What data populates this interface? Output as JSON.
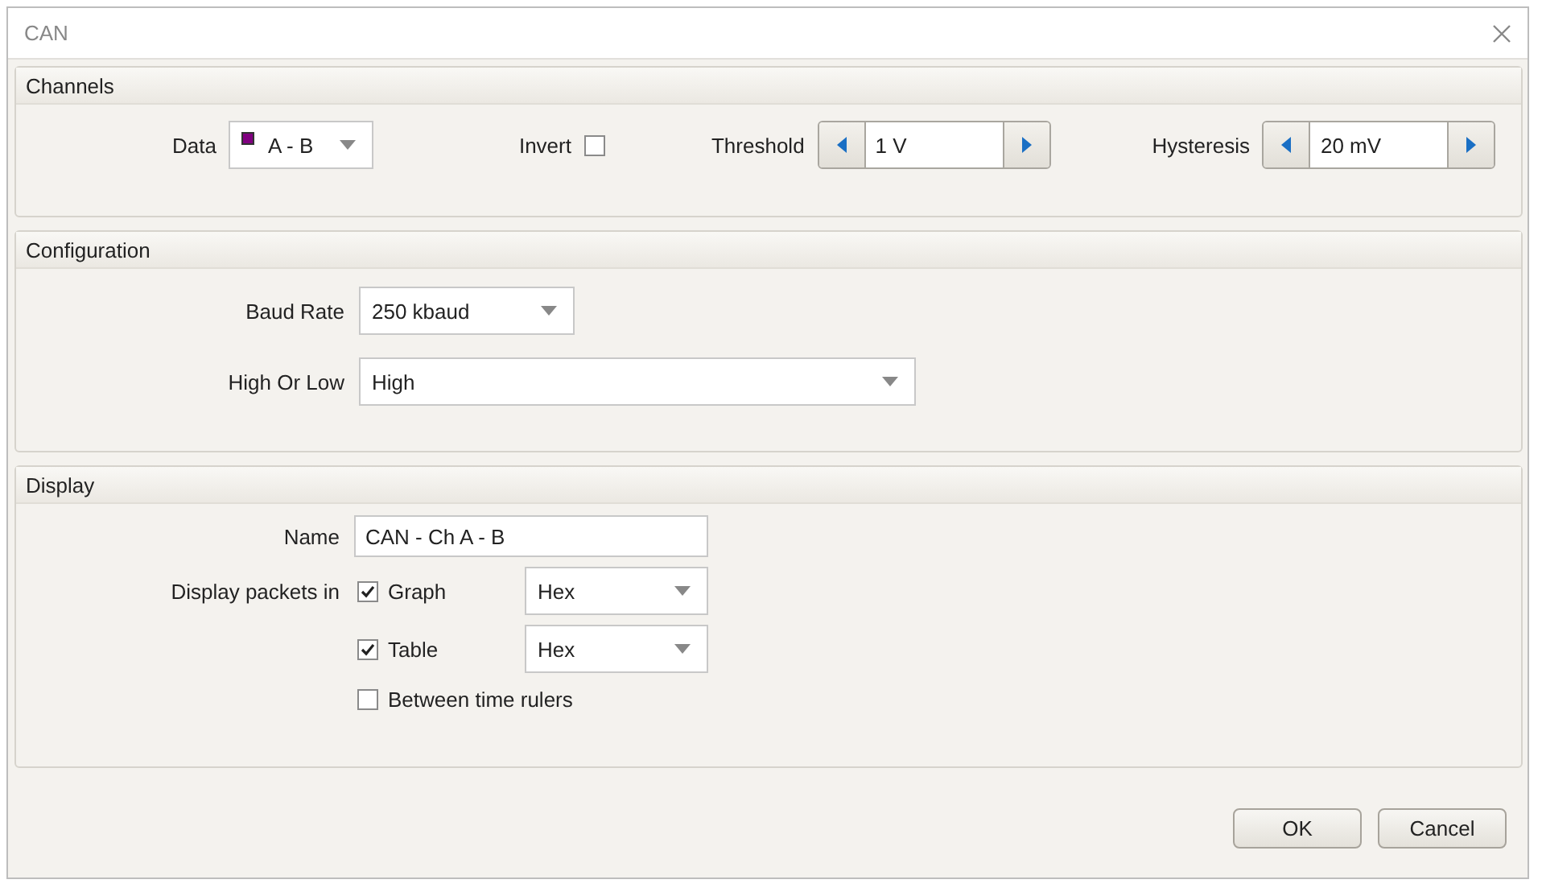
{
  "window": {
    "title": "CAN"
  },
  "channels": {
    "title": "Channels",
    "data": {
      "label": "Data",
      "value": "A - B",
      "color": "#800080"
    },
    "invert": {
      "label": "Invert",
      "checked": false
    },
    "threshold": {
      "label": "Threshold",
      "value": "1 V"
    },
    "hysteresis": {
      "label": "Hysteresis",
      "value": "20 mV"
    }
  },
  "configuration": {
    "title": "Configuration",
    "baud_rate": {
      "label": "Baud Rate",
      "value": "250 kbaud"
    },
    "high_or_low": {
      "label": "High Or Low",
      "value": "High"
    }
  },
  "display": {
    "title": "Display",
    "name": {
      "label": "Name",
      "value": "CAN - Ch A - B"
    },
    "packets_label": "Display packets in",
    "options": [
      {
        "label": "Graph",
        "checked": true,
        "format": "Hex"
      },
      {
        "label": "Table",
        "checked": true,
        "format": "Hex"
      },
      {
        "label": "Between time rulers",
        "checked": false
      }
    ]
  },
  "buttons": [
    "OK",
    "Cancel"
  ]
}
